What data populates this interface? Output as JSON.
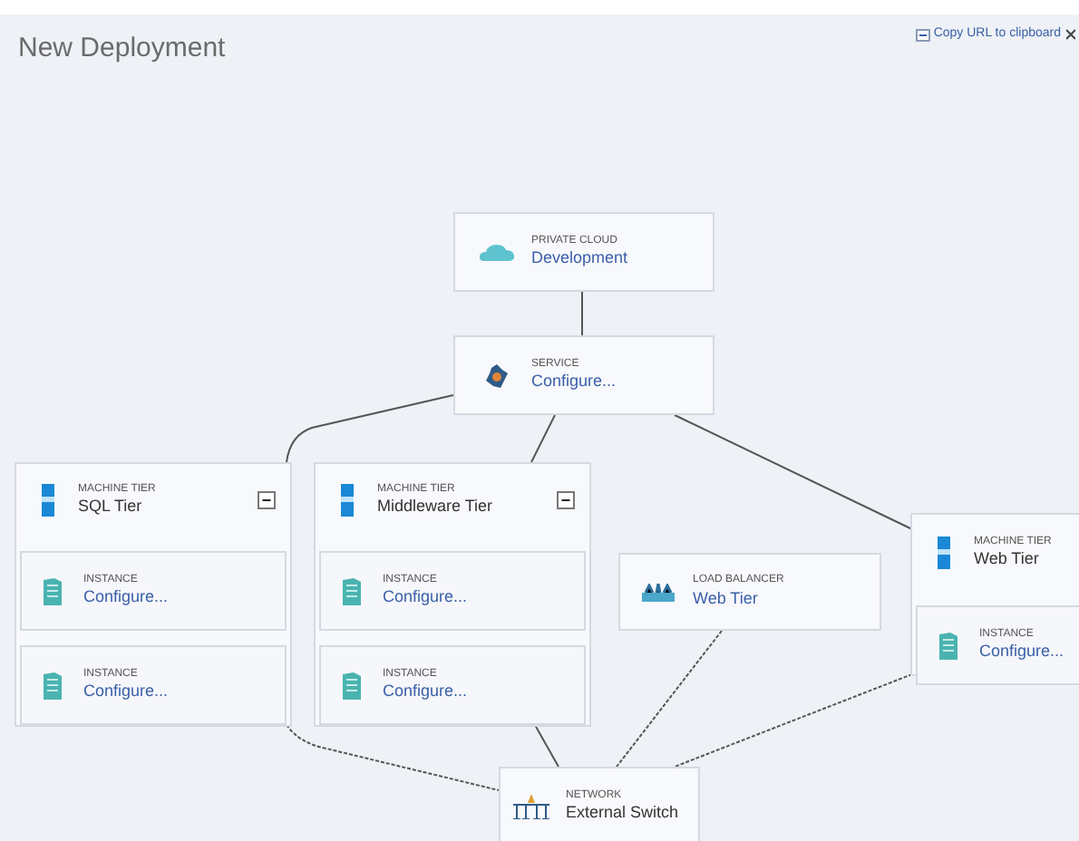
{
  "title": "New Deployment",
  "copy_url": {
    "label": "Copy URL to clipboard"
  },
  "private_cloud": {
    "label": "PRIVATE CLOUD",
    "value": "Development"
  },
  "service": {
    "label": "SERVICE",
    "value": "Configure..."
  },
  "machine_tiers": [
    {
      "label": "MACHINE TIER",
      "name": "SQL Tier",
      "toggle": "−",
      "instances": [
        {
          "label": "INSTANCE",
          "value": "Configure..."
        },
        {
          "label": "INSTANCE",
          "value": "Configure..."
        }
      ]
    },
    {
      "label": "MACHINE TIER",
      "name": "Middleware Tier",
      "toggle": "−",
      "instances": [
        {
          "label": "INSTANCE",
          "value": "Configure..."
        },
        {
          "label": "INSTANCE",
          "value": "Configure..."
        }
      ]
    },
    {
      "label": "MACHINE TIER",
      "name": "Web Tier",
      "instances": [
        {
          "label": "INSTANCE",
          "value": "Configure..."
        }
      ]
    }
  ],
  "load_balancer": {
    "label": "LOAD BALANCER",
    "value": "Web Tier"
  },
  "network": {
    "label": "NETWORK",
    "value": "External Switch"
  }
}
